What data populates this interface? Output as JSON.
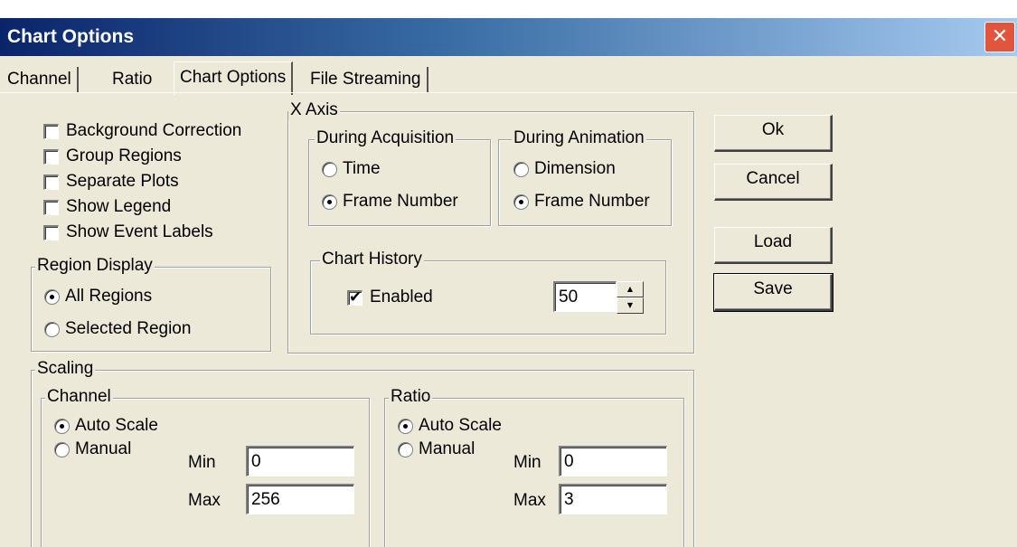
{
  "window": {
    "title": "Chart Options",
    "close_glyph": "✕"
  },
  "tabs": [
    {
      "label": "Channel"
    },
    {
      "label": "Ratio"
    },
    {
      "label": "Chart Options",
      "active": true
    },
    {
      "label": "File Streaming"
    }
  ],
  "options": {
    "items": [
      {
        "label": "Background Correction",
        "checked": false
      },
      {
        "label": "Group Regions",
        "checked": false
      },
      {
        "label": "Separate Plots",
        "checked": false
      },
      {
        "label": "Show Legend",
        "checked": false
      },
      {
        "label": "Show Event Labels",
        "checked": false
      }
    ]
  },
  "region_display": {
    "title": "Region Display",
    "all": "All Regions",
    "selected": "Selected Region",
    "value": "All Regions"
  },
  "x_axis": {
    "title": "X Axis",
    "acquisition": {
      "title": "During Acquisition",
      "opt1": "Time",
      "opt2": "Frame Number",
      "value": "Frame Number"
    },
    "animation": {
      "title": "During Animation",
      "opt1": "Dimension",
      "opt2": "Frame Number",
      "value": "Frame Number"
    },
    "history": {
      "title": "Chart History",
      "enabled_label": "Enabled",
      "enabled": true,
      "value": "50"
    }
  },
  "scaling": {
    "title": "Scaling",
    "channel": {
      "title": "Channel",
      "auto": "Auto Scale",
      "manual": "Manual",
      "value": "Auto Scale",
      "min_label": "Min",
      "min": "0",
      "max_label": "Max",
      "max": "256"
    },
    "ratio": {
      "title": "Ratio",
      "auto": "Auto Scale",
      "manual": "Manual",
      "value": "Auto Scale",
      "min_label": "Min",
      "min": "0",
      "max_label": "Max",
      "max": "3"
    }
  },
  "buttons": {
    "ok": "Ok",
    "cancel": "Cancel",
    "load": "Load",
    "save": "Save"
  },
  "colors": {
    "face": "#ece9d8",
    "title_start": "#0a246a",
    "close": "#e0553b"
  }
}
